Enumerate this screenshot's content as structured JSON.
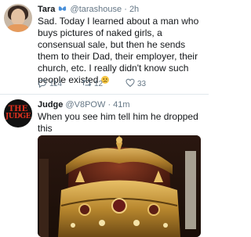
{
  "tweet1": {
    "display_name": "Tara",
    "handle": "@tarashouse",
    "separator": "·",
    "time": "2h",
    "text": "Sad. Today I learned about a man who buys pictures of naked girls, a consensual sale, but then he sends them to their Dad, their employer, their church, etc. I really didn't know such people existed",
    "reply_count": "114",
    "retweet_count": "12",
    "like_count": "33",
    "icons": {
      "name_emoji": "butterfly-icon",
      "text_emoji": "sad-face-emoji-icon",
      "reply": "reply-icon",
      "retweet": "retweet-icon",
      "like": "heart-icon"
    }
  },
  "tweet2": {
    "display_name": "Judge",
    "handle": "@V8POW",
    "separator": "·",
    "time": "41m",
    "text": "When you see him tell him he dropped this",
    "avatar_text_top": "THE",
    "avatar_text_bottom": "JUDGE"
  },
  "colors": {
    "text": "#14171a",
    "muted": "#657786",
    "divider": "#e1e8ed",
    "butterfly": "#4a90d9",
    "logo": "#e0301e"
  }
}
